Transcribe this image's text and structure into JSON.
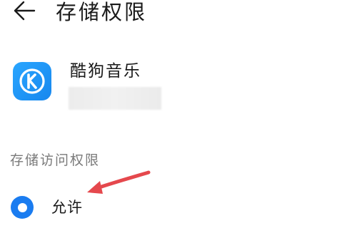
{
  "header": {
    "back_icon": "arrow-left-icon",
    "title": "存储权限"
  },
  "app": {
    "icon": "kugou-k-icon",
    "icon_letter": "K",
    "icon_color": "#1e90f5",
    "name": "酷狗音乐"
  },
  "section": {
    "title": "存储访问权限"
  },
  "options": [
    {
      "label": "允许",
      "selected": true
    }
  ],
  "colors": {
    "accent": "#1a7cf0",
    "annotation_arrow": "#e5484d"
  }
}
